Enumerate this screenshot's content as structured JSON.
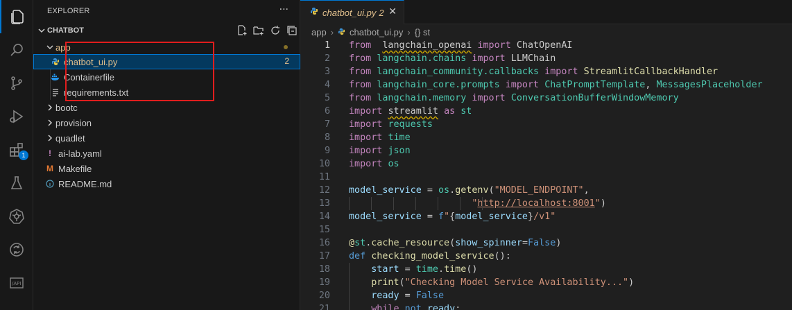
{
  "activity_bar": {
    "items": [
      {
        "name": "explorer-icon",
        "active": true
      },
      {
        "name": "search-icon"
      },
      {
        "name": "source-control-icon"
      },
      {
        "name": "run-debug-icon"
      },
      {
        "name": "extensions-icon",
        "badge": "1"
      },
      {
        "name": "testing-icon"
      },
      {
        "name": "kubernetes-icon"
      },
      {
        "name": "sync-icon"
      },
      {
        "name": "api-icon"
      }
    ]
  },
  "sidebar": {
    "title": "EXPLORER",
    "more": "···",
    "section_label": "CHATBOT",
    "tree": [
      {
        "label": "app",
        "type": "folder-open",
        "depth": 1,
        "color": "#e2c08d"
      },
      {
        "label": "chatbot_ui.py",
        "type": "python",
        "depth": 2,
        "selected": true,
        "count": "2",
        "color": "#e2c08d"
      },
      {
        "label": "Containerfile",
        "type": "docker",
        "depth": 2
      },
      {
        "label": "requirements.txt",
        "type": "text",
        "depth": 2
      },
      {
        "label": "bootc",
        "type": "folder",
        "depth": 1
      },
      {
        "label": "provision",
        "type": "folder",
        "depth": 1
      },
      {
        "label": "quadlet",
        "type": "folder",
        "depth": 1
      },
      {
        "label": "ai-lab.yaml",
        "type": "yaml",
        "depth": 1
      },
      {
        "label": "Makefile",
        "type": "makefile",
        "depth": 1
      },
      {
        "label": "README.md",
        "type": "info",
        "depth": 1
      }
    ]
  },
  "editor": {
    "tab": {
      "name": "chatbot_ui.py",
      "count": "2",
      "close": "✕"
    },
    "breadcrumb": {
      "folder": "app",
      "file": "chatbot_ui.py",
      "symbol": "{} st"
    },
    "lines": [
      {
        "n": "1",
        "tokens": [
          [
            "ctrl",
            "from"
          ],
          [
            "",
            "  "
          ],
          [
            "sq",
            "langchain_openai"
          ],
          [
            "",
            " "
          ],
          [
            "ctrl",
            "import"
          ],
          [
            "",
            " ChatOpenAI"
          ]
        ]
      },
      {
        "n": "2",
        "tokens": [
          [
            "ctrl",
            "from"
          ],
          [
            "",
            " "
          ],
          [
            "mod",
            "langchain.chains"
          ],
          [
            "",
            " "
          ],
          [
            "ctrl",
            "import"
          ],
          [
            "",
            " LLMChain"
          ]
        ]
      },
      {
        "n": "3",
        "tokens": [
          [
            "ctrl",
            "from"
          ],
          [
            "",
            " "
          ],
          [
            "mod",
            "langchain_community.callbacks"
          ],
          [
            "",
            " "
          ],
          [
            "ctrl",
            "import"
          ],
          [
            "",
            " "
          ],
          [
            "fn",
            "StreamlitCallbackHandler"
          ]
        ]
      },
      {
        "n": "4",
        "tokens": [
          [
            "ctrl",
            "from"
          ],
          [
            "",
            " "
          ],
          [
            "mod",
            "langchain_core.prompts"
          ],
          [
            "",
            " "
          ],
          [
            "ctrl",
            "import"
          ],
          [
            "",
            " "
          ],
          [
            "mod",
            "ChatPromptTemplate"
          ],
          [
            "",
            ", "
          ],
          [
            "mod",
            "MessagesPlaceholder"
          ]
        ]
      },
      {
        "n": "5",
        "tokens": [
          [
            "ctrl",
            "from"
          ],
          [
            "",
            " "
          ],
          [
            "mod",
            "langchain.memory"
          ],
          [
            "",
            " "
          ],
          [
            "ctrl",
            "import"
          ],
          [
            "",
            " "
          ],
          [
            "mod",
            "ConversationBufferWindowMemory"
          ]
        ]
      },
      {
        "n": "6",
        "tokens": [
          [
            "ctrl",
            "import"
          ],
          [
            "",
            " "
          ],
          [
            "sq",
            "streamlit"
          ],
          [
            "",
            " "
          ],
          [
            "ctrl",
            "as"
          ],
          [
            "",
            " "
          ],
          [
            "mod",
            "st"
          ]
        ]
      },
      {
        "n": "7",
        "tokens": [
          [
            "ctrl",
            "import"
          ],
          [
            "",
            " "
          ],
          [
            "mod",
            "requests"
          ]
        ]
      },
      {
        "n": "8",
        "tokens": [
          [
            "ctrl",
            "import"
          ],
          [
            "",
            " "
          ],
          [
            "mod",
            "time"
          ]
        ]
      },
      {
        "n": "9",
        "tokens": [
          [
            "ctrl",
            "import"
          ],
          [
            "",
            " "
          ],
          [
            "mod",
            "json"
          ]
        ]
      },
      {
        "n": "10",
        "tokens": [
          [
            "ctrl",
            "import"
          ],
          [
            "",
            " "
          ],
          [
            "mod",
            "os"
          ]
        ]
      },
      {
        "n": "11",
        "tokens": []
      },
      {
        "n": "12",
        "tokens": [
          [
            "var",
            "model_service"
          ],
          [
            "",
            " = "
          ],
          [
            "mod",
            "os"
          ],
          [
            "",
            "."
          ],
          [
            "fn",
            "getenv"
          ],
          [
            "",
            "("
          ],
          [
            "str",
            "\"MODEL_ENDPOINT\""
          ],
          [
            "",
            ","
          ]
        ]
      },
      {
        "n": "13",
        "tokens": [
          [
            "",
            "                      "
          ],
          [
            "str",
            "\""
          ],
          [
            "url",
            "http://localhost:8001"
          ],
          [
            "str",
            "\""
          ],
          [
            "",
            ")"
          ]
        ]
      },
      {
        "n": "14",
        "tokens": [
          [
            "var",
            "model_service"
          ],
          [
            "",
            " = "
          ],
          [
            "kw",
            "f"
          ],
          [
            "str",
            "\""
          ],
          [
            "",
            "{"
          ],
          [
            "var",
            "model_service"
          ],
          [
            "",
            "}"
          ],
          [
            "str",
            "/v1\""
          ]
        ]
      },
      {
        "n": "15",
        "tokens": []
      },
      {
        "n": "16",
        "tokens": [
          [
            "deco",
            "@"
          ],
          [
            "mod",
            "st"
          ],
          [
            "",
            "."
          ],
          [
            "fn",
            "cache_resource"
          ],
          [
            "",
            "("
          ],
          [
            "var",
            "show_spinner"
          ],
          [
            "",
            "="
          ],
          [
            "kw",
            "False"
          ],
          [
            "",
            ")"
          ]
        ]
      },
      {
        "n": "17",
        "tokens": [
          [
            "kw",
            "def"
          ],
          [
            "",
            " "
          ],
          [
            "fn",
            "checking_model_service"
          ],
          [
            "",
            "():"
          ]
        ]
      },
      {
        "n": "18",
        "tokens": [
          [
            "",
            "    "
          ],
          [
            "var",
            "start"
          ],
          [
            "",
            " = "
          ],
          [
            "mod",
            "time"
          ],
          [
            "",
            "."
          ],
          [
            "fn",
            "time"
          ],
          [
            "",
            "()"
          ]
        ]
      },
      {
        "n": "19",
        "tokens": [
          [
            "",
            "    "
          ],
          [
            "fn",
            "print"
          ],
          [
            "",
            "("
          ],
          [
            "str",
            "\"Checking Model Service Availability...\""
          ],
          [
            "",
            ")"
          ]
        ]
      },
      {
        "n": "20",
        "tokens": [
          [
            "",
            "    "
          ],
          [
            "var",
            "ready"
          ],
          [
            "",
            " = "
          ],
          [
            "kw",
            "False"
          ]
        ]
      },
      {
        "n": "21",
        "tokens": [
          [
            "",
            "    "
          ],
          [
            "ctrl",
            "while"
          ],
          [
            "",
            " "
          ],
          [
            "kw",
            "not"
          ],
          [
            "",
            " "
          ],
          [
            "var",
            "ready"
          ],
          [
            "",
            ":"
          ]
        ]
      }
    ]
  }
}
